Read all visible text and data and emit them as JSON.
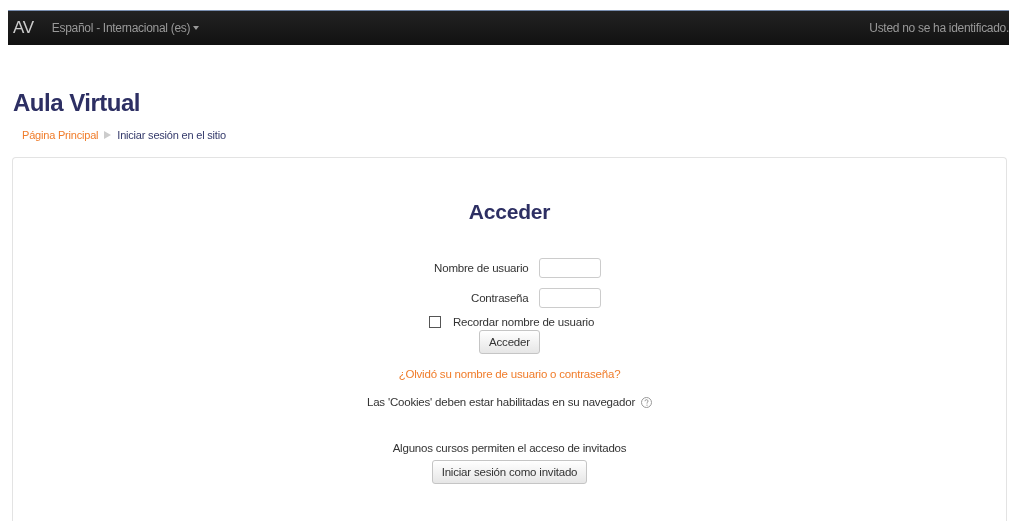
{
  "navbar": {
    "brand": "AV",
    "language": "Español - Internacional (es)",
    "login_status": "Usted no se ha identificado."
  },
  "page_title": "Aula Virtual",
  "breadcrumb": [
    {
      "label": "Página Principal",
      "link": true
    },
    {
      "label": "Iniciar sesión en el sitio",
      "link": false
    }
  ],
  "login": {
    "heading": "Acceder",
    "fields": [
      {
        "label": "Nombre de usuario"
      },
      {
        "label": "Contraseña"
      }
    ],
    "remember": {
      "label": "Recordar nombre de usuario",
      "checked": false
    },
    "submit": "Acceder",
    "forgot_link": "¿Olvidó su nombre de usuario o contraseña?",
    "cookies_note": "Las 'Cookies' deben estar habilitadas en su navegador",
    "guest_note": "Algunos cursos permiten el acceso de invitados",
    "guest_button": "Iniciar sesión como invitado"
  }
}
